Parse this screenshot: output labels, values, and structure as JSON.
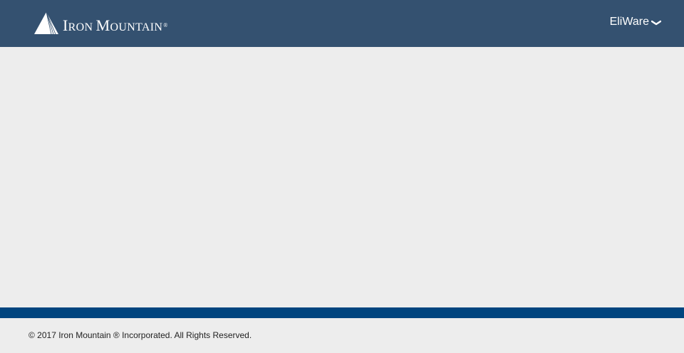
{
  "header": {
    "logo_text": "Iron Mountain",
    "logo_initial_1": "I",
    "logo_rest_1": "RON",
    "logo_initial_2": "M",
    "logo_rest_2": "OUNTAIN",
    "logo_registered": "®",
    "user_name": "EliWare",
    "user_menu_icon": "chevron-down-icon"
  },
  "main": {},
  "footer": {
    "copyright": "© 2017 Iron Mountain ® Incorporated. All Rights Reserved."
  },
  "colors": {
    "header_bg": "#345170",
    "content_bg": "#ededed",
    "footer_bar": "#01457f"
  }
}
